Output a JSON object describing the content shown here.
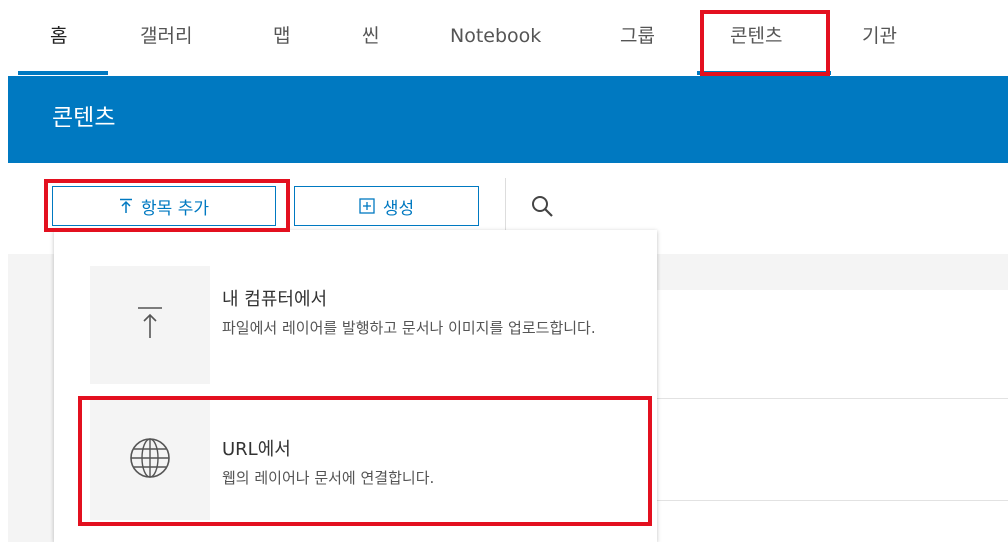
{
  "nav": {
    "tabs": [
      "홈",
      "갤러리",
      "맵",
      "씬",
      "Notebook",
      "그룹",
      "콘텐츠",
      "기관"
    ]
  },
  "header": {
    "title": "콘텐츠"
  },
  "toolbar": {
    "add_item_label": "항목 추가",
    "create_label": "생성"
  },
  "dropdown": {
    "items": [
      {
        "title": "내 컴퓨터에서",
        "desc": "파일에서 레이어를 발행하고 문서나 이미지를 업로드합니다."
      },
      {
        "title": "URL에서",
        "desc": "웹의 레이어나 문서에 연결합니다."
      }
    ]
  },
  "colors": {
    "accent": "#0079c1",
    "highlight": "#e3101f"
  },
  "icons": [
    "upload-icon",
    "add-box-icon",
    "search-icon",
    "globe-icon"
  ]
}
